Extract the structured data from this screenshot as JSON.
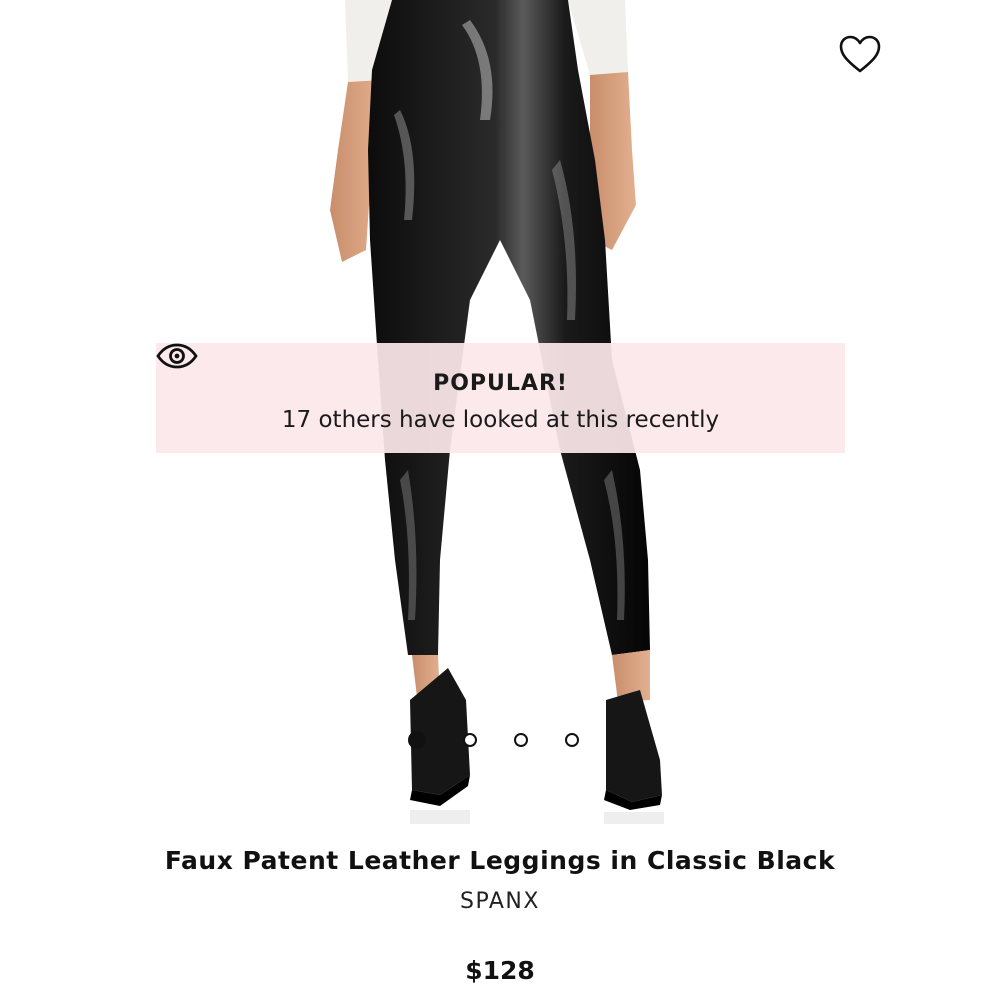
{
  "product": {
    "title": "Faux Patent Leather Leggings in Classic Black",
    "brand": "SPANX",
    "price": "$128",
    "image_alt": "Model wearing black faux patent leather leggings with black pumps"
  },
  "banner": {
    "icon": "eye-icon",
    "title": "POPULAR!",
    "text": "17 others have looked at this recently"
  },
  "wishlist": {
    "icon": "heart-outline-icon"
  },
  "carousel": {
    "total": 4,
    "active_index": 0
  },
  "colors": {
    "banner_bg": "#fbe7ea",
    "text": "#111111",
    "background": "#ffffff"
  }
}
